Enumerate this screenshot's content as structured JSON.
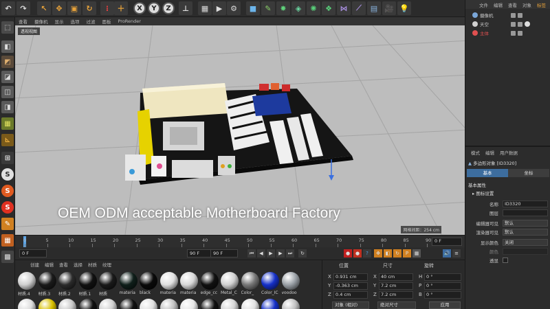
{
  "viewport": {
    "menu": [
      "查看",
      "摄像机",
      "显示",
      "选项",
      "过滤",
      "面板",
      "ProRender"
    ],
    "label": "透视视图",
    "caption": "OEM ODM acceptable Motherboard Factory",
    "grid_spacing": "网格间距：254 cm"
  },
  "toolbar": {
    "axis_x": "X",
    "axis_y": "Y",
    "axis_z": "Z"
  },
  "timeline": {
    "ticks": [
      "0",
      "5",
      "10",
      "15",
      "20",
      "25",
      "30",
      "35",
      "40",
      "45",
      "50",
      "55",
      "60",
      "65",
      "70",
      "75",
      "80",
      "85",
      "90"
    ],
    "frame_right": "0 F"
  },
  "transport": {
    "start": "0 F",
    "current": "90 F",
    "end": "90 F"
  },
  "materials": {
    "menu": [
      "创建",
      "编辑",
      "查看",
      "选择",
      "材质",
      "纹理"
    ],
    "row1": [
      {
        "label": "材质.4",
        "color": "#cfcfcf"
      },
      {
        "label": "材质.3",
        "color": "#1a1a1a"
      },
      {
        "label": "材质.2",
        "color": "#2b2b2b"
      },
      {
        "label": "材质.1",
        "color": "#111111"
      },
      {
        "label": "材质",
        "color": "#1a1a1a"
      },
      {
        "label": "materia",
        "color": "#0f1f1a"
      },
      {
        "label": "black",
        "color": "#0a0a0a"
      },
      {
        "label": "materia",
        "color": "#e0e0e0"
      },
      {
        "label": "materia",
        "color": "#d8d8d8"
      },
      {
        "label": "edge_cc",
        "color": "#111111"
      },
      {
        "label": "Metal_C",
        "color": "#d0d0d0"
      },
      {
        "label": "Color_",
        "color": "#777777"
      },
      {
        "label": "Color_IC",
        "color": "#1530c8"
      },
      {
        "label": "voodoo",
        "color": "#9aa0a6"
      }
    ],
    "row2": [
      {
        "color": "#dcdcdc"
      },
      {
        "color": "#d8c000"
      },
      {
        "color": "#c8c8c8"
      },
      {
        "color": "#101010"
      },
      {
        "color": "#d0d0d0"
      },
      {
        "color": "#111111"
      },
      {
        "color": "#e0e0e0"
      },
      {
        "color": "#c0c0c0"
      },
      {
        "color": "#e6e6e6"
      },
      {
        "color": "#101010"
      },
      {
        "color": "#d4d4d4"
      },
      {
        "color": "#e0e0e0"
      },
      {
        "color": "#1530c8"
      },
      {
        "color": "#bfbfbf"
      }
    ]
  },
  "coords": {
    "headers": {
      "position": "位置",
      "size": "尺寸",
      "rotation": "旋转"
    },
    "rows": [
      {
        "axis": "X",
        "pos": "0.931 cm",
        "saxis": "X",
        "size": "40 cm",
        "raxis": "H",
        "rot": "0 °"
      },
      {
        "axis": "Y",
        "pos": "-0.363 cm",
        "saxis": "Y",
        "size": "7.2 cm",
        "raxis": "P",
        "rot": "0 °"
      },
      {
        "axis": "Z",
        "pos": "0.4 cm",
        "saxis": "Z",
        "size": "7.2 cm",
        "raxis": "B",
        "rot": "0 °"
      }
    ],
    "mode_object": "对象 (相对)",
    "mode_size": "绝对尺寸",
    "apply": "应用"
  },
  "objects": {
    "menu": [
      "文件",
      "编辑",
      "查看",
      "对象",
      "标签"
    ],
    "items": [
      {
        "name": "摄像机",
        "color": "#7aa6d8"
      },
      {
        "name": "天空",
        "color": "#d0d0d0"
      },
      {
        "name": "主体",
        "color": "#e05050"
      }
    ]
  },
  "attributes": {
    "menu": [
      "模式",
      "编辑",
      "用户数据"
    ],
    "title": "多边形对象 [ID3320]",
    "tabs": [
      "基本",
      "坐标"
    ],
    "section": "基本属性",
    "subsection": "图标设置",
    "fields": {
      "name_label": "名称",
      "name_value": "ID3320",
      "layer_label": "图层",
      "layer_value": "",
      "editor_label": "编辑器可见",
      "editor_value": "默认",
      "render_label": "渲染器可见",
      "render_value": "默认",
      "color_label": "显示颜色",
      "color_value": "关闭",
      "display_label": "颜色",
      "display_value": "",
      "transparent_label": "透显"
    }
  }
}
